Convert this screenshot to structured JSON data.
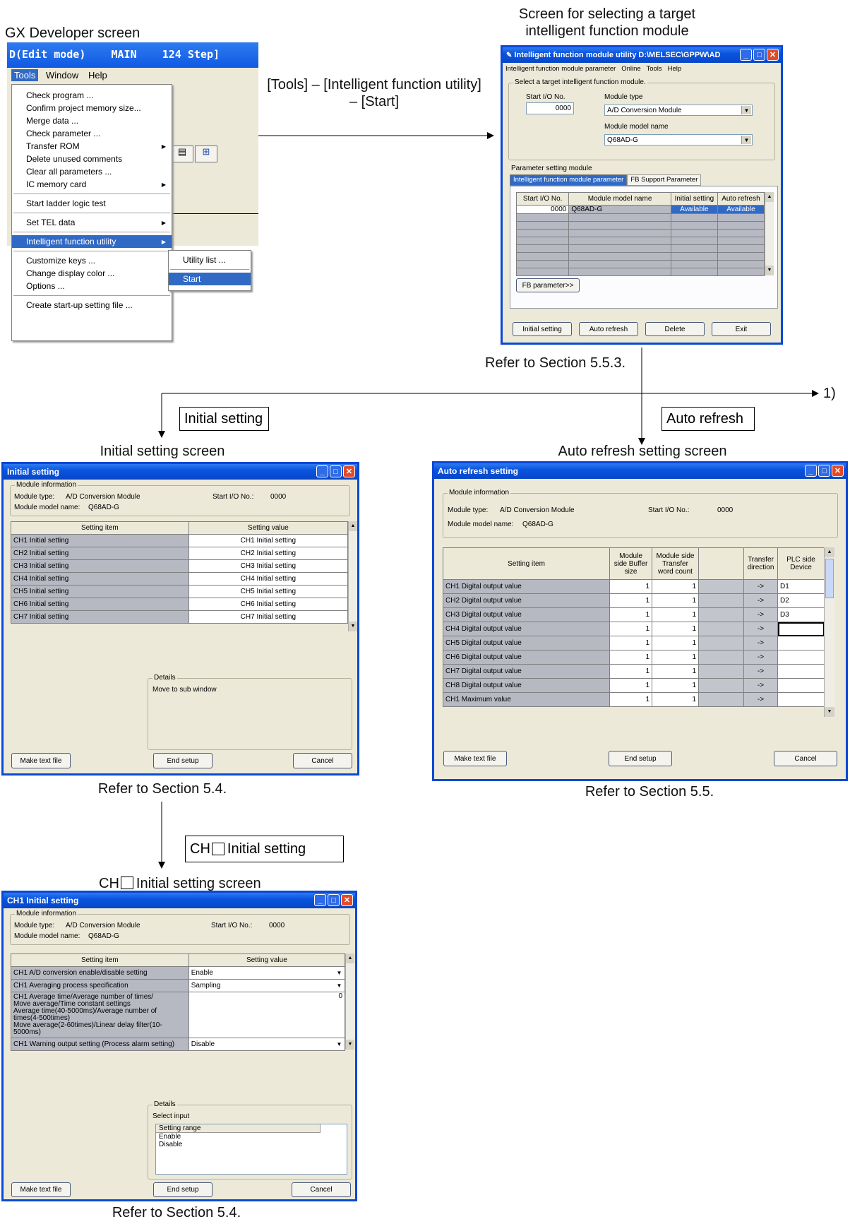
{
  "captions": {
    "gx_title": "GX Developer screen",
    "target_screen": "Screen for selecting a target intelligent function module",
    "menu_path": "[Tools] – [Intelligent function utility] – [Start]",
    "refer_553": "Refer to Section 5.5.3.",
    "arrow_1": "1)",
    "initial_setting_box": "Initial setting",
    "auto_refresh_box": "Auto refresh",
    "initial_setting_screen": "Initial setting screen",
    "auto_refresh_screen": "Auto refresh setting screen",
    "refer_54_a": "Refer to Section 5.4.",
    "refer_55": "Refer to Section 5.5.",
    "ch_initial_setting_box_pre": "CH",
    "ch_initial_setting_box_post": "Initial setting",
    "ch_screen_pre": "CH",
    "ch_screen_post": "Initial setting screen",
    "refer_54_b": "Refer to Section 5.4."
  },
  "gx": {
    "titlebar": "D(Edit mode)    MAIN    124 Step]",
    "menubar": [
      "Tools",
      "Window",
      "Help"
    ],
    "menu_items": [
      "Check program ...",
      "Confirm project memory size...",
      "Merge data ...",
      "Check parameter ...",
      "Transfer ROM",
      "Delete unused comments",
      "Clear all parameters ...",
      "IC memory card",
      "Start ladder logic test",
      "Set TEL data",
      "Intelligent function utility",
      "Customize keys ...",
      "Change display color ...",
      "Options ...",
      "Create start-up setting file ..."
    ],
    "submenu": [
      "Utility list ...",
      "Start"
    ]
  },
  "utility": {
    "title": "Intelligent function module utility D:\\MELSEC\\GPPW\\AD",
    "menubar": [
      "Intelligent function module parameter",
      "Online",
      "Tools",
      "Help"
    ],
    "group_label": "Select a target intelligent function module.",
    "start_io_label": "Start I/O No.",
    "start_io_value": "0000",
    "module_type_label": "Module type",
    "module_type_value": "A/D Conversion Module",
    "model_name_label": "Module model name",
    "model_name_value": "Q68AD-G",
    "param_module_label": "Parameter setting module",
    "tabs": [
      "Intelligent function module parameter",
      "FB Support Parameter"
    ],
    "headers": [
      "Start I/O No.",
      "Module model name",
      "Initial setting",
      "Auto refresh"
    ],
    "row": [
      "0000",
      "Q68AD-G",
      "Available",
      "Available"
    ],
    "fb_button": "FB parameter>>",
    "buttons": [
      "Initial setting",
      "Auto refresh",
      "Delete",
      "Exit"
    ]
  },
  "initial": {
    "title": "Initial setting",
    "module_info": "Module information",
    "module_type_label": "Module type:",
    "module_type_value": "A/D Conversion Module",
    "start_io_label": "Start I/O No.:",
    "start_io_value": "0000",
    "model_label": "Module model name:",
    "model_value": "Q68AD-G",
    "headers": [
      "Setting item",
      "Setting value"
    ],
    "rows": [
      [
        "CH1 Initial setting",
        "CH1 Initial setting"
      ],
      [
        "CH2 Initial setting",
        "CH2 Initial setting"
      ],
      [
        "CH3 Initial setting",
        "CH3 Initial setting"
      ],
      [
        "CH4 Initial setting",
        "CH4 Initial setting"
      ],
      [
        "CH5 Initial setting",
        "CH5 Initial setting"
      ],
      [
        "CH6 Initial setting",
        "CH6 Initial setting"
      ],
      [
        "CH7 Initial setting",
        "CH7 Initial setting"
      ]
    ],
    "details_label": "Details",
    "details_text": "Move to sub window",
    "buttons": [
      "Make text file",
      "End setup",
      "Cancel"
    ]
  },
  "auto": {
    "title": "Auto refresh setting",
    "module_info": "Module information",
    "module_type_label": "Module type:",
    "module_type_value": "A/D Conversion Module",
    "start_io_label": "Start I/O No.:",
    "start_io_value": "0000",
    "model_label": "Module model name:",
    "model_value": "Q68AD-G",
    "headers": [
      "Setting item",
      "Module side Buffer size",
      "Module side Transfer word count",
      "",
      "Transfer direction",
      "PLC side Device"
    ],
    "rows": [
      [
        "CH1 Digital output value",
        "1",
        "1",
        "->",
        "D1"
      ],
      [
        "CH2 Digital output value",
        "1",
        "1",
        "->",
        "D2"
      ],
      [
        "CH3 Digital output value",
        "1",
        "1",
        "->",
        "D3"
      ],
      [
        "CH4 Digital output value",
        "1",
        "1",
        "->",
        ""
      ],
      [
        "CH5 Digital output value",
        "1",
        "1",
        "->",
        ""
      ],
      [
        "CH6 Digital output value",
        "1",
        "1",
        "->",
        ""
      ],
      [
        "CH7 Digital output value",
        "1",
        "1",
        "->",
        ""
      ],
      [
        "CH8 Digital output value",
        "1",
        "1",
        "->",
        ""
      ],
      [
        "CH1 Maximum value",
        "1",
        "1",
        "->",
        ""
      ]
    ],
    "buttons": [
      "Make text file",
      "End setup",
      "Cancel"
    ]
  },
  "ch1": {
    "title": "CH1 Initial setting",
    "module_info": "Module information",
    "module_type_label": "Module type:",
    "module_type_value": "A/D Conversion Module",
    "start_io_label": "Start I/O No.:",
    "start_io_value": "0000",
    "model_label": "Module model name:",
    "model_value": "Q68AD-G",
    "headers": [
      "Setting item",
      "Setting value"
    ],
    "rows": [
      [
        "CH1 A/D conversion enable/disable setting",
        "Enable"
      ],
      [
        "CH1 Averaging process specification",
        "Sampling"
      ],
      [
        "CH1 Average time/Average number of times/\nMove average/Time constant settings\nAverage time(40-5000ms)/Average number of\ntimes(4-500times)\nMove average(2-60times)/Linear delay filter(10-5000ms)",
        "0"
      ],
      [
        "CH1 Warning output setting (Process alarm setting)",
        "Disable"
      ]
    ],
    "details_label": "Details",
    "details_text": "Select input",
    "range_header": "Setting range",
    "range_items": [
      "Enable",
      "Disable"
    ],
    "buttons": [
      "Make text file",
      "End setup",
      "Cancel"
    ]
  }
}
